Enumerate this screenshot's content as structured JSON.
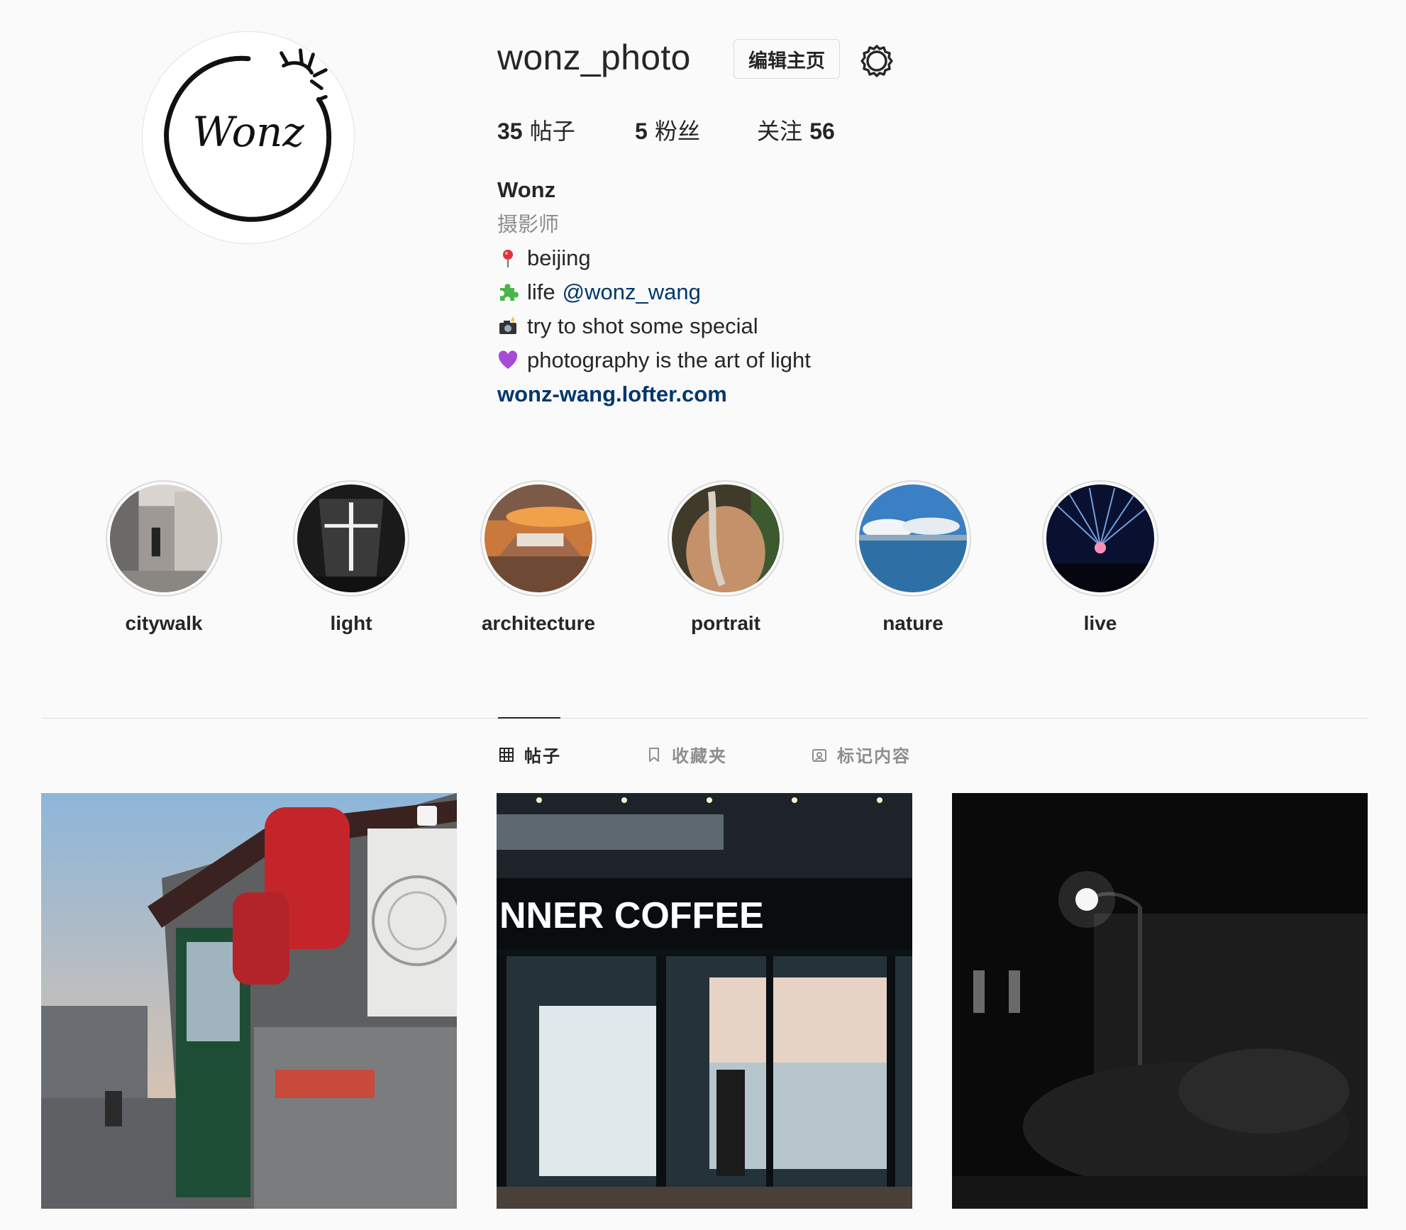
{
  "profile": {
    "username": "wonz_photo",
    "edit_label": "编辑主页",
    "logo_text": "Wonz"
  },
  "stats": [
    {
      "count": "35",
      "label": "帖子",
      "order": "count-first"
    },
    {
      "count": "5",
      "label": "粉丝",
      "order": "count-first"
    },
    {
      "count": "56",
      "label": "关注",
      "order": "label-first"
    }
  ],
  "bio": {
    "name": "Wonz",
    "category": "摄影师",
    "lines": [
      {
        "icon": "pin-icon",
        "text": "beijing"
      },
      {
        "icon": "puzzle-icon",
        "text": "life",
        "mention": "@wonz_wang"
      },
      {
        "icon": "camera-flash-icon",
        "text": "try to shot some special"
      },
      {
        "icon": "purple-heart-icon",
        "text": "photography is the art of light"
      }
    ],
    "website": "wonz-wang.lofter.com"
  },
  "highlights": [
    {
      "label": "citywalk"
    },
    {
      "label": "light"
    },
    {
      "label": "architecture"
    },
    {
      "label": "portrait"
    },
    {
      "label": "nature"
    },
    {
      "label": "live"
    }
  ],
  "tabs": [
    {
      "label": "帖子",
      "icon": "grid-icon",
      "active": true
    },
    {
      "label": "收藏夹",
      "icon": "bookmark-icon",
      "active": false
    },
    {
      "label": "标记内容",
      "icon": "tagged-icon",
      "active": false
    }
  ],
  "posts": [
    {
      "subject": "hutong-lanterns",
      "badge": "carousel-icon"
    },
    {
      "subject": "coffee-shop-night",
      "sign_text": "NNER COFFEE"
    },
    {
      "subject": "street-lamp-night"
    }
  ],
  "colors": {
    "background": "#fafafa",
    "text": "#262626",
    "muted": "#8e8e8e",
    "link": "#00376b",
    "border": "#dbdbdb"
  }
}
